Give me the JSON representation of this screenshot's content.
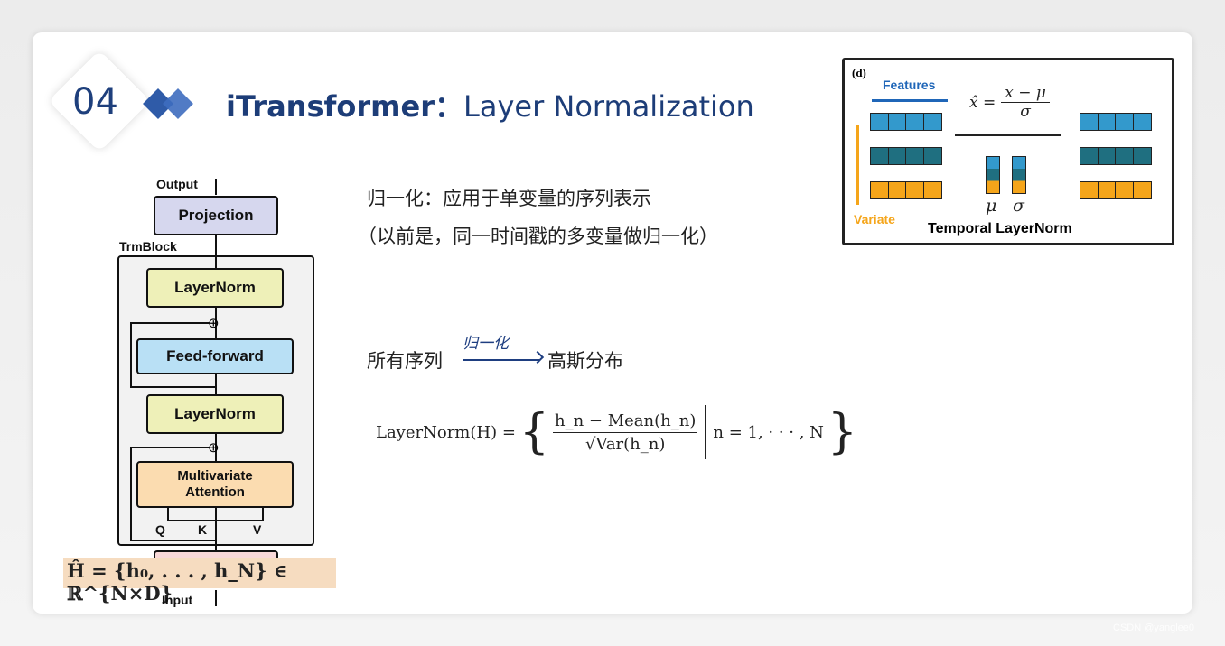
{
  "slide": {
    "number": "04",
    "title_bold": "iTransformer：",
    "title_rest": "Layer Normalization"
  },
  "diagram": {
    "output_label": "Output",
    "projection": "Projection",
    "trmblock": "TrmBlock",
    "layernorm_top": "LayerNorm",
    "feed_forward": "Feed-forward",
    "layernorm_bottom": "LayerNorm",
    "attention_line1": "Multivariate",
    "attention_line2": "Attention",
    "q": "Q",
    "k": "K",
    "v": "V",
    "input_label": "Input",
    "embedding_formula": "Ĥ = {h₀, . . . , h_N} ∈ ℝ^{N×D}",
    "plus_symbol": "⊕"
  },
  "text": {
    "line1": "归一化：应用于单变量的序列表示",
    "line2": "（以前是，同一时间戳的多变量做归一化）",
    "all_series": "所有序列",
    "arrow_note": "归一化",
    "gaussian": "高斯分布"
  },
  "formula": {
    "lhs": "LayerNorm(H) =",
    "numerator": "h_n − Mean(h_n)",
    "denominator": "√Var(h_n)",
    "condition": "n = 1, · · · , N"
  },
  "figure_d": {
    "panel": "(d)",
    "features": "Features",
    "variate": "Variate",
    "equation_lhs": "x̂ =",
    "equation_num": "x − μ",
    "equation_den": "σ",
    "mu": "μ",
    "sigma": "σ",
    "caption": "Temporal LayerNorm",
    "colors": {
      "blue": "#3399cc",
      "teal": "#1f6f80",
      "orange": "#f5a51a"
    }
  },
  "watermark": "CSDN @yanglee0"
}
